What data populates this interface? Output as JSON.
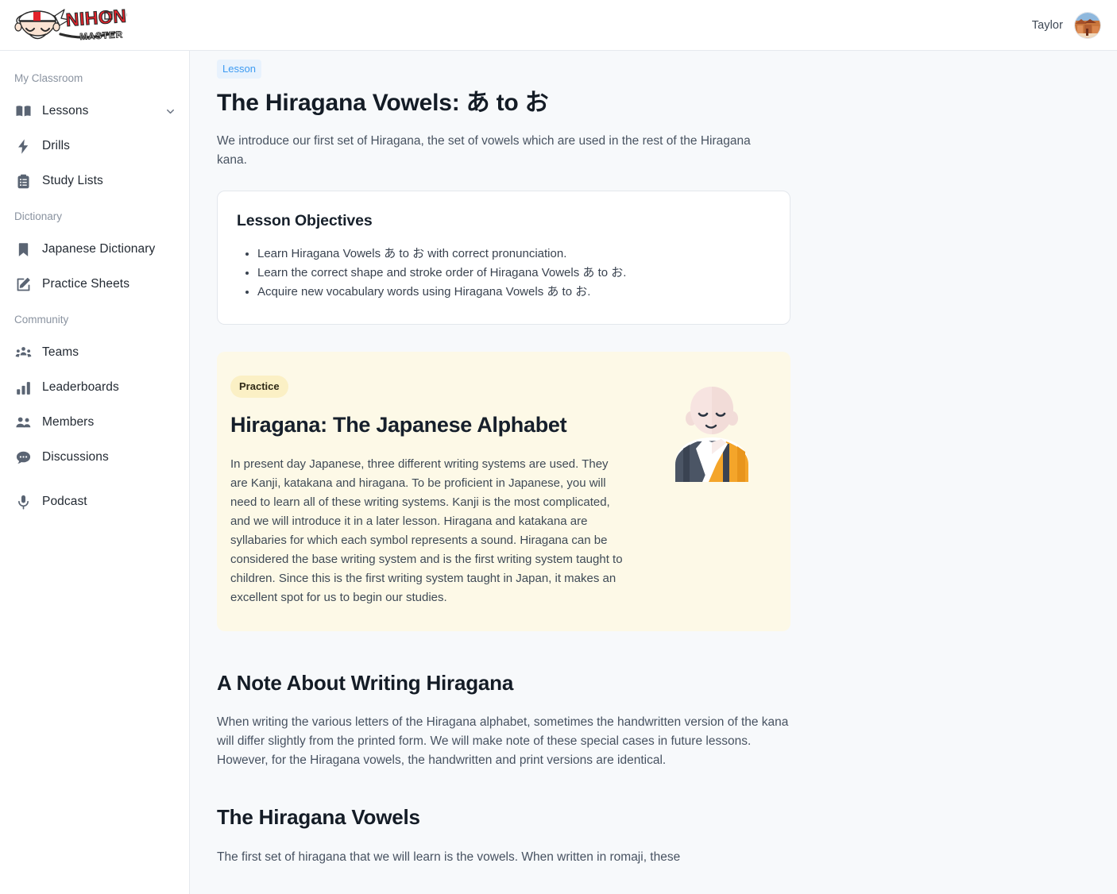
{
  "brand": {
    "logo_text_main": "NIHONGO",
    "logo_text_sub": "MASTER",
    "logo_alt": "nihongo-master-logo"
  },
  "topbar": {
    "user_name": "Taylor",
    "avatar_alt": "user-avatar-photo"
  },
  "sidebar": {
    "sections": [
      {
        "label": "My Classroom",
        "items": [
          {
            "label": "Lessons",
            "icon": "book-icon",
            "has_chevron": true
          },
          {
            "label": "Drills",
            "icon": "bolt-icon",
            "has_chevron": false
          },
          {
            "label": "Study Lists",
            "icon": "clipboard-icon",
            "has_chevron": false
          }
        ]
      },
      {
        "label": "Dictionary",
        "items": [
          {
            "label": "Japanese Dictionary",
            "icon": "bookmark-icon",
            "has_chevron": false
          },
          {
            "label": "Practice Sheets",
            "icon": "pencil-square-icon",
            "has_chevron": false
          }
        ]
      },
      {
        "label": "Community",
        "items": [
          {
            "label": "Teams",
            "icon": "people-group-icon",
            "has_chevron": false
          },
          {
            "label": "Leaderboards",
            "icon": "bar-chart-icon",
            "has_chevron": false
          },
          {
            "label": "Members",
            "icon": "two-users-icon",
            "has_chevron": false
          },
          {
            "label": "Discussions",
            "icon": "chat-bubble-icon",
            "has_chevron": false
          },
          {
            "label": "Podcast",
            "icon": "microphone-icon",
            "has_chevron": false
          }
        ]
      }
    ]
  },
  "lesson": {
    "badge": "Lesson",
    "title": "The Hiragana Vowels: あ to お",
    "intro": "We introduce our first set of Hiragana, the set of vowels which are used in the rest of the Hiragana kana.",
    "objectives": {
      "heading": "Lesson Objectives",
      "items": [
        "Learn Hiragana Vowels あ to お with correct pronunciation.",
        "Learn the correct shape and stroke order of Hiragana Vowels あ to お.",
        "Acquire new vocabulary words using Hiragana Vowels あ to お."
      ]
    },
    "practice_card": {
      "badge": "Practice",
      "title": "Hiragana: The Japanese Alphabet",
      "body": "In present day Japanese, three different writing systems are used. They are Kanji, katakana and hiragana. To be proficient in Japanese, you will need to learn all of these writing systems. Kanji is the most complicated, and we will introduce it in a later lesson. Hiragana and katakana are syllabaries for which each symbol represents a sound. Hiragana can be considered the base writing system and is the first writing system taught to children. Since this is the first writing system taught in Japan, it makes an excellent spot for us to begin our studies.",
      "illustration_alt": "monk-illustration"
    },
    "sections": [
      {
        "heading": "A Note About Writing Hiragana",
        "body": "When writing the various letters of the Hiragana alphabet, sometimes the handwritten version of the kana will differ slightly from the printed form. We will make note of these special cases in future lessons. However, for the Hiragana vowels, the handwritten and print versions are identical."
      },
      {
        "heading": "The Hiragana Vowels",
        "body": "The first set of hiragana that we will learn is the vowels. When written in romaji, these"
      }
    ]
  },
  "colors": {
    "page_background": "#f7f9fb",
    "panel_white": "#ffffff",
    "lesson_badge_bg": "#e8f2fd",
    "lesson_badge_text": "#3d9bf1",
    "practice_card_bg": "#fdf9e7",
    "practice_badge_bg": "#fbf0c5",
    "heading_text": "#141c26",
    "body_text": "#475261",
    "sidebar_icon": "#5a6473",
    "logo_red": "#e2222b",
    "monk_robe_dark": "#4b5565",
    "monk_robe_orange": "#f4a52a"
  }
}
